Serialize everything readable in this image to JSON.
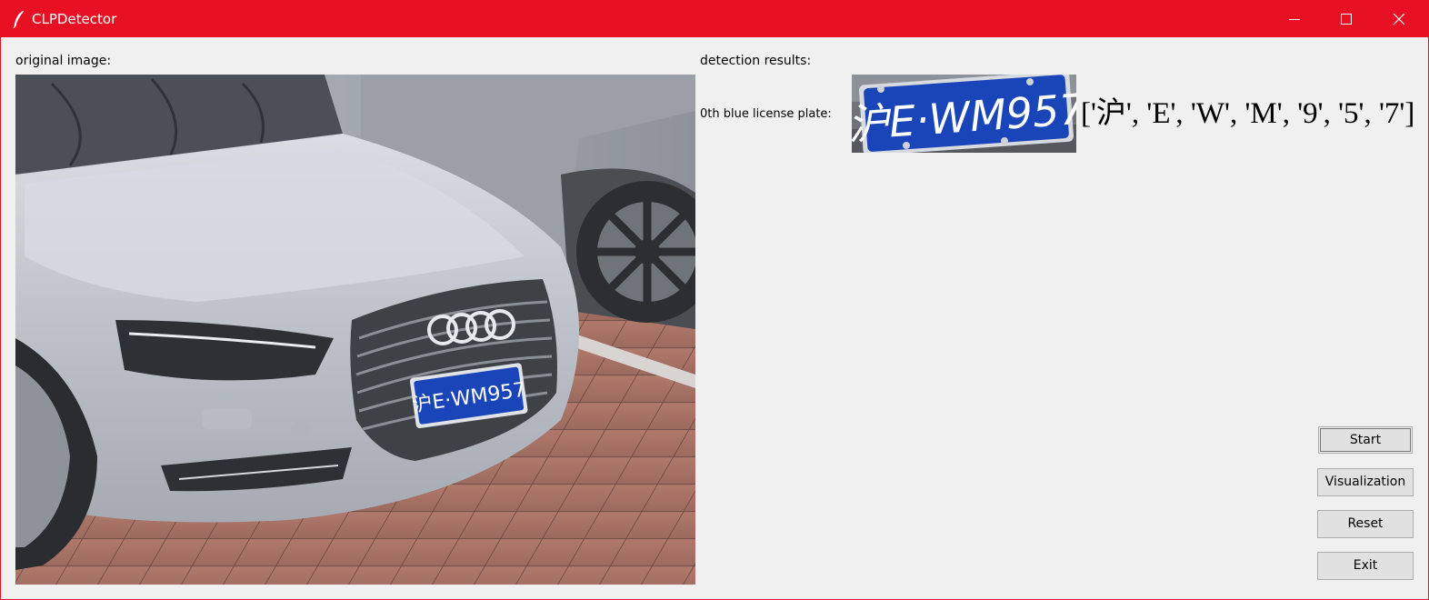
{
  "window": {
    "title": "CLPDetector",
    "title_icon": "feather-icon",
    "controls": [
      "minimize-icon",
      "maximize-icon",
      "close-icon"
    ],
    "accent": "#e81123"
  },
  "left_panel": {
    "label": "original image:"
  },
  "right_panel": {
    "label": "detection results:",
    "plate_label": "0th blue license plate:",
    "plate_text": "沪E·WM957",
    "result": "['沪', 'E', 'W', 'M', '9', '5', '7']"
  },
  "buttons": {
    "start": "Start",
    "visualization": "Visualization",
    "reset": "Reset",
    "exit": "Exit"
  },
  "colors": {
    "plate_blue": "#1a45b8",
    "background": "#f0f0f0"
  }
}
